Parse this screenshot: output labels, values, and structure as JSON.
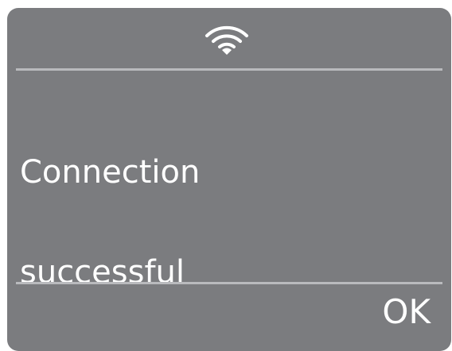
{
  "dialog": {
    "status_icon": "wifi-icon",
    "message_line1": "Connection",
    "message_line2": "successful",
    "ok_label": "OK"
  },
  "colors": {
    "background": "#7b7c7f",
    "divider": "#b9babd",
    "text": "#ffffff"
  }
}
